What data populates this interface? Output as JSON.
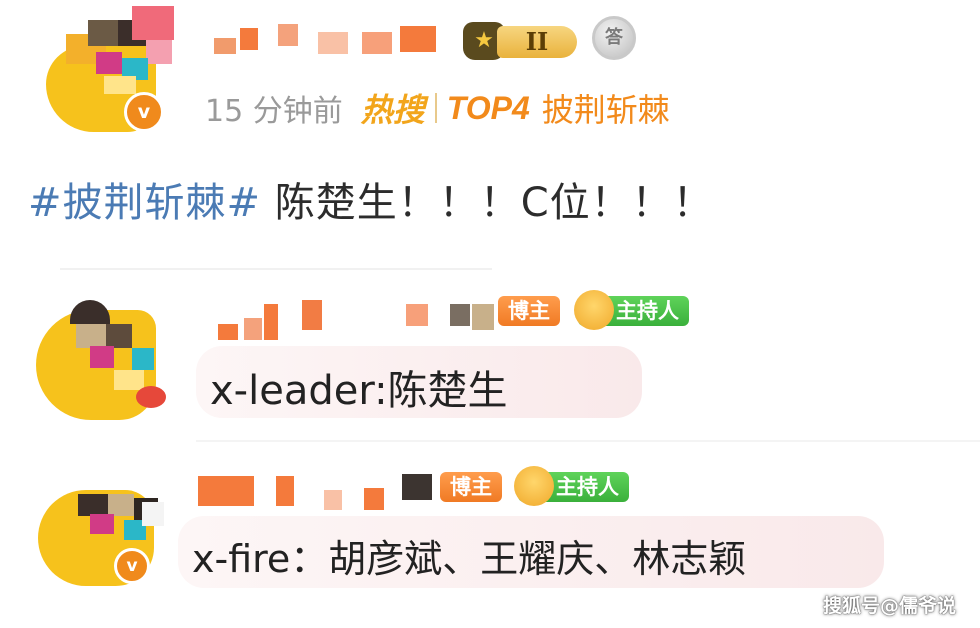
{
  "post": {
    "time": "15 分钟前",
    "hot_search_label": "热搜",
    "hot_rank": "TOP4",
    "hot_topic": "披荆斩棘",
    "level_badge": "II",
    "medal_text": "答",
    "hashtag": "#披荆斩棘#",
    "content": " 陈楚生！！！C位！！！"
  },
  "comments": [
    {
      "tag_blogger": "博主",
      "tag_host": "主持人",
      "text": "x-leader:陈楚生"
    },
    {
      "tag_blogger": "博主",
      "tag_host": "主持人",
      "text": "x-fire：胡彦斌、王耀庆、林志颖"
    }
  ],
  "verified_mark": "v",
  "watermark": "搜狐号@儒爷说",
  "colors": {
    "hashtag": "#4b7bb4",
    "hot": "#f28a1b",
    "blogger_tag": "#f07a24",
    "host_tag": "#3ab03b",
    "verified": "#f08a1c"
  }
}
